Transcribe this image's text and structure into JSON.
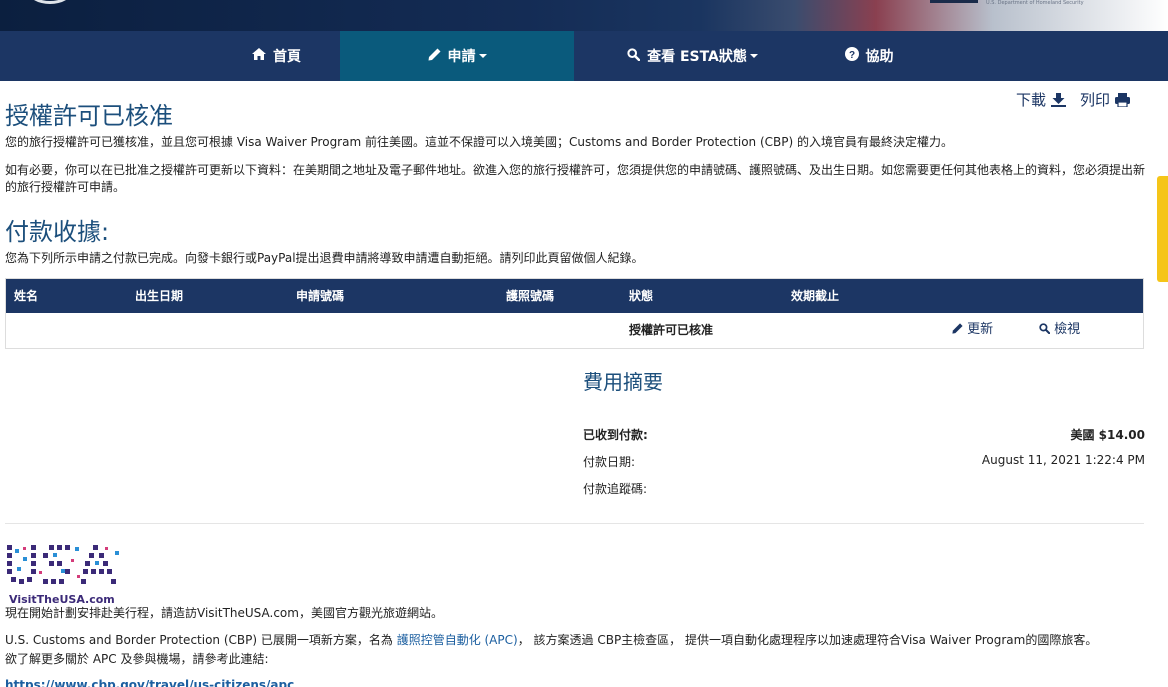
{
  "nav": {
    "items": [
      {
        "label": "首頁",
        "icon": "home-icon"
      },
      {
        "label": "申請",
        "icon": "pencil-icon"
      },
      {
        "label": "查看 ESTA狀態",
        "icon": "search-icon"
      },
      {
        "label": "協助",
        "icon": "question-circle-icon"
      }
    ],
    "active_index": 1
  },
  "header": {
    "title": "授權許可已核准",
    "download_label": "下載",
    "print_label": "列印"
  },
  "intro": {
    "p1": "您的旅行授權許可已獲核准，並且您可根據 Visa Waiver Program 前往美國。這並不保證可以入境美國；Customs and Border Protection (CBP) 的入境官員有最終決定權力。",
    "p2": "如有必要，你可以在已批准之授權許可更新以下資料：在美期間之地址及電子郵件地址。欲進入您的旅行授權許可，您須提供您的申請號碼、護照號碼、及出生日期。如您需要更任何其他表格上的資料，您必須提出新的旅行授權許可申請。"
  },
  "payment": {
    "title": "付款收據:",
    "note": "您為下列所示申請之付款已完成。向發卡銀行或PayPal提出退費申請將導致申請遭自動拒絕。請列印此頁留做個人紀錄。",
    "table": {
      "headers": [
        "姓名",
        "出生日期",
        "申請號碼",
        "護照號碼",
        "狀態",
        "效期截止"
      ],
      "row": {
        "status": "授權許可已核准",
        "update_label": "更新",
        "view_label": "檢視"
      }
    }
  },
  "fees": {
    "title": "費用摘要",
    "received_label": "已收到付款:",
    "received_value": "美國 $14.00",
    "date_label": "付款日期:",
    "date_value": "August 11, 2021 1:22:4 PM",
    "tracking_label": "付款追蹤碼:"
  },
  "footer": {
    "logo_text": "VisitTheUSA.com",
    "visit_text": "現在開始計劃安排赴美行程，請造訪VisitTheUSA.com，美國官方觀光旅遊網站。",
    "apc_before": "U.S. Customs and Border Protection (CBP) 已展開一項新方案，名為 ",
    "apc_link": "護照控管自動化 (APC)",
    "apc_after": "， 該方案透過 CBP主檢查區， 提供一項自動化處理程序以加速處理符合Visa Waiver Program的國際旅客。",
    "apc_more": "欲了解更多關於 APC 及參與機場，請參考此連結:",
    "apc_url": "https://www.cbp.gov/travel/us-citizens/apc"
  }
}
